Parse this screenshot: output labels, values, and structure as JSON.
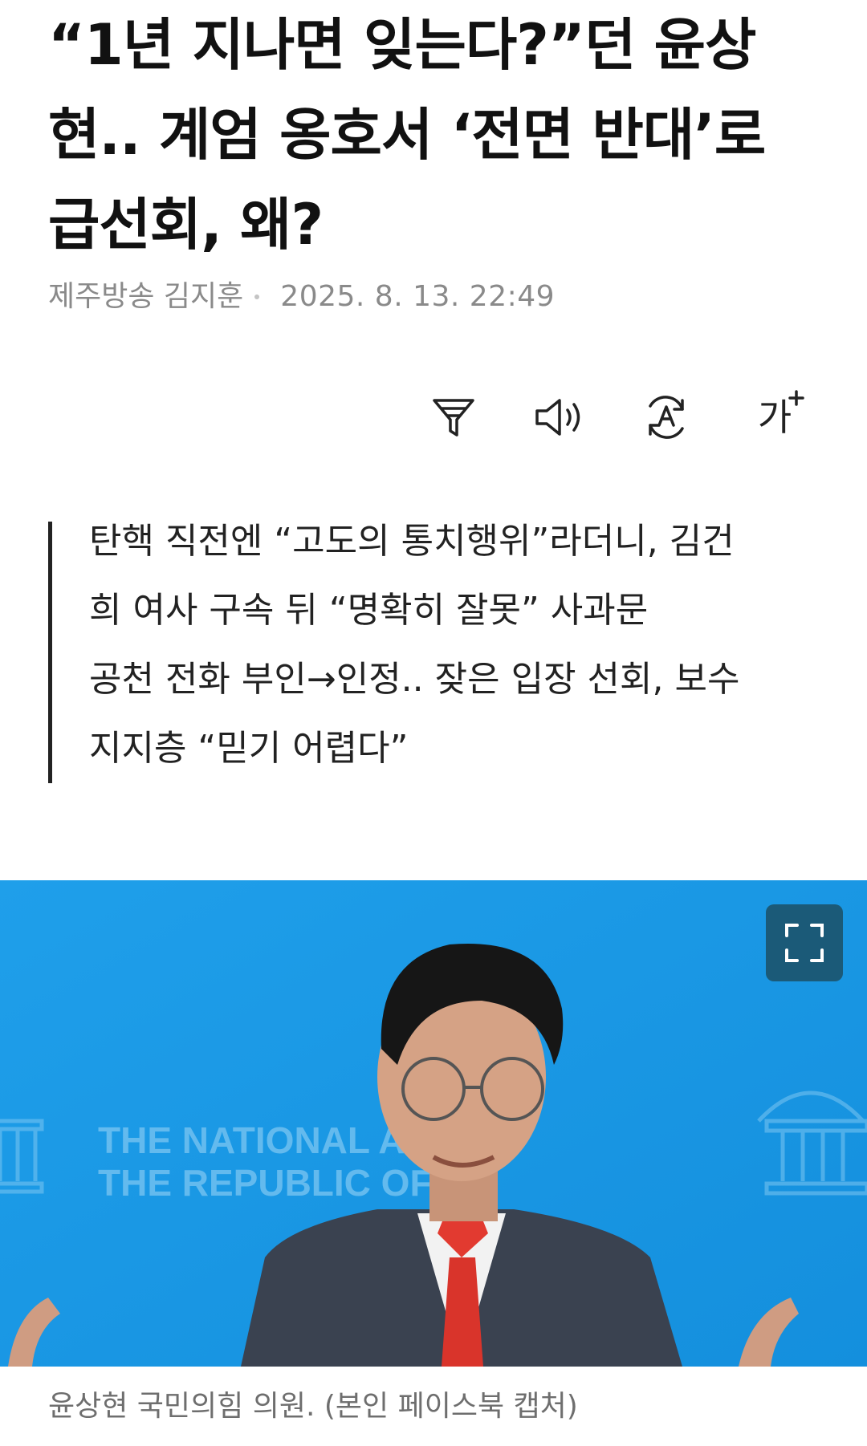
{
  "article": {
    "headline_lines": [
      "“1년 지나면 잊는다?”던 윤상",
      "현.. 계엄 옹호서 ‘전면 반대’로",
      "급선회, 왜?"
    ],
    "source": "제주방송 김지훈",
    "date": "2025. 8. 13. 22:49"
  },
  "toolbar": {
    "icons": [
      "filter-icon",
      "speaker-icon",
      "translate-icon",
      "font-size-icon"
    ],
    "font_size_label": "가"
  },
  "summary": {
    "lines": [
      "탄핵 직전엔 “고도의 통치행위”라더니, 김건",
      "희 여사 구속 뒤 “명확히 잘못” 사과문",
      "공천 전화 부인→인정.. 잦은 입장 선회, 보수",
      "지지층 “믿기 어렵다”"
    ]
  },
  "photo": {
    "backdrop_text_lines": [
      "THE NATIONAL AS",
      "THE REPUBLIC OF"
    ],
    "expand_icon": "expand-icon",
    "caption": "윤상현 국민의힘 의원. (본인 페이스북 캡처)",
    "colors": {
      "background": "#1a9be6",
      "expand_button": "#1b5a78"
    }
  }
}
